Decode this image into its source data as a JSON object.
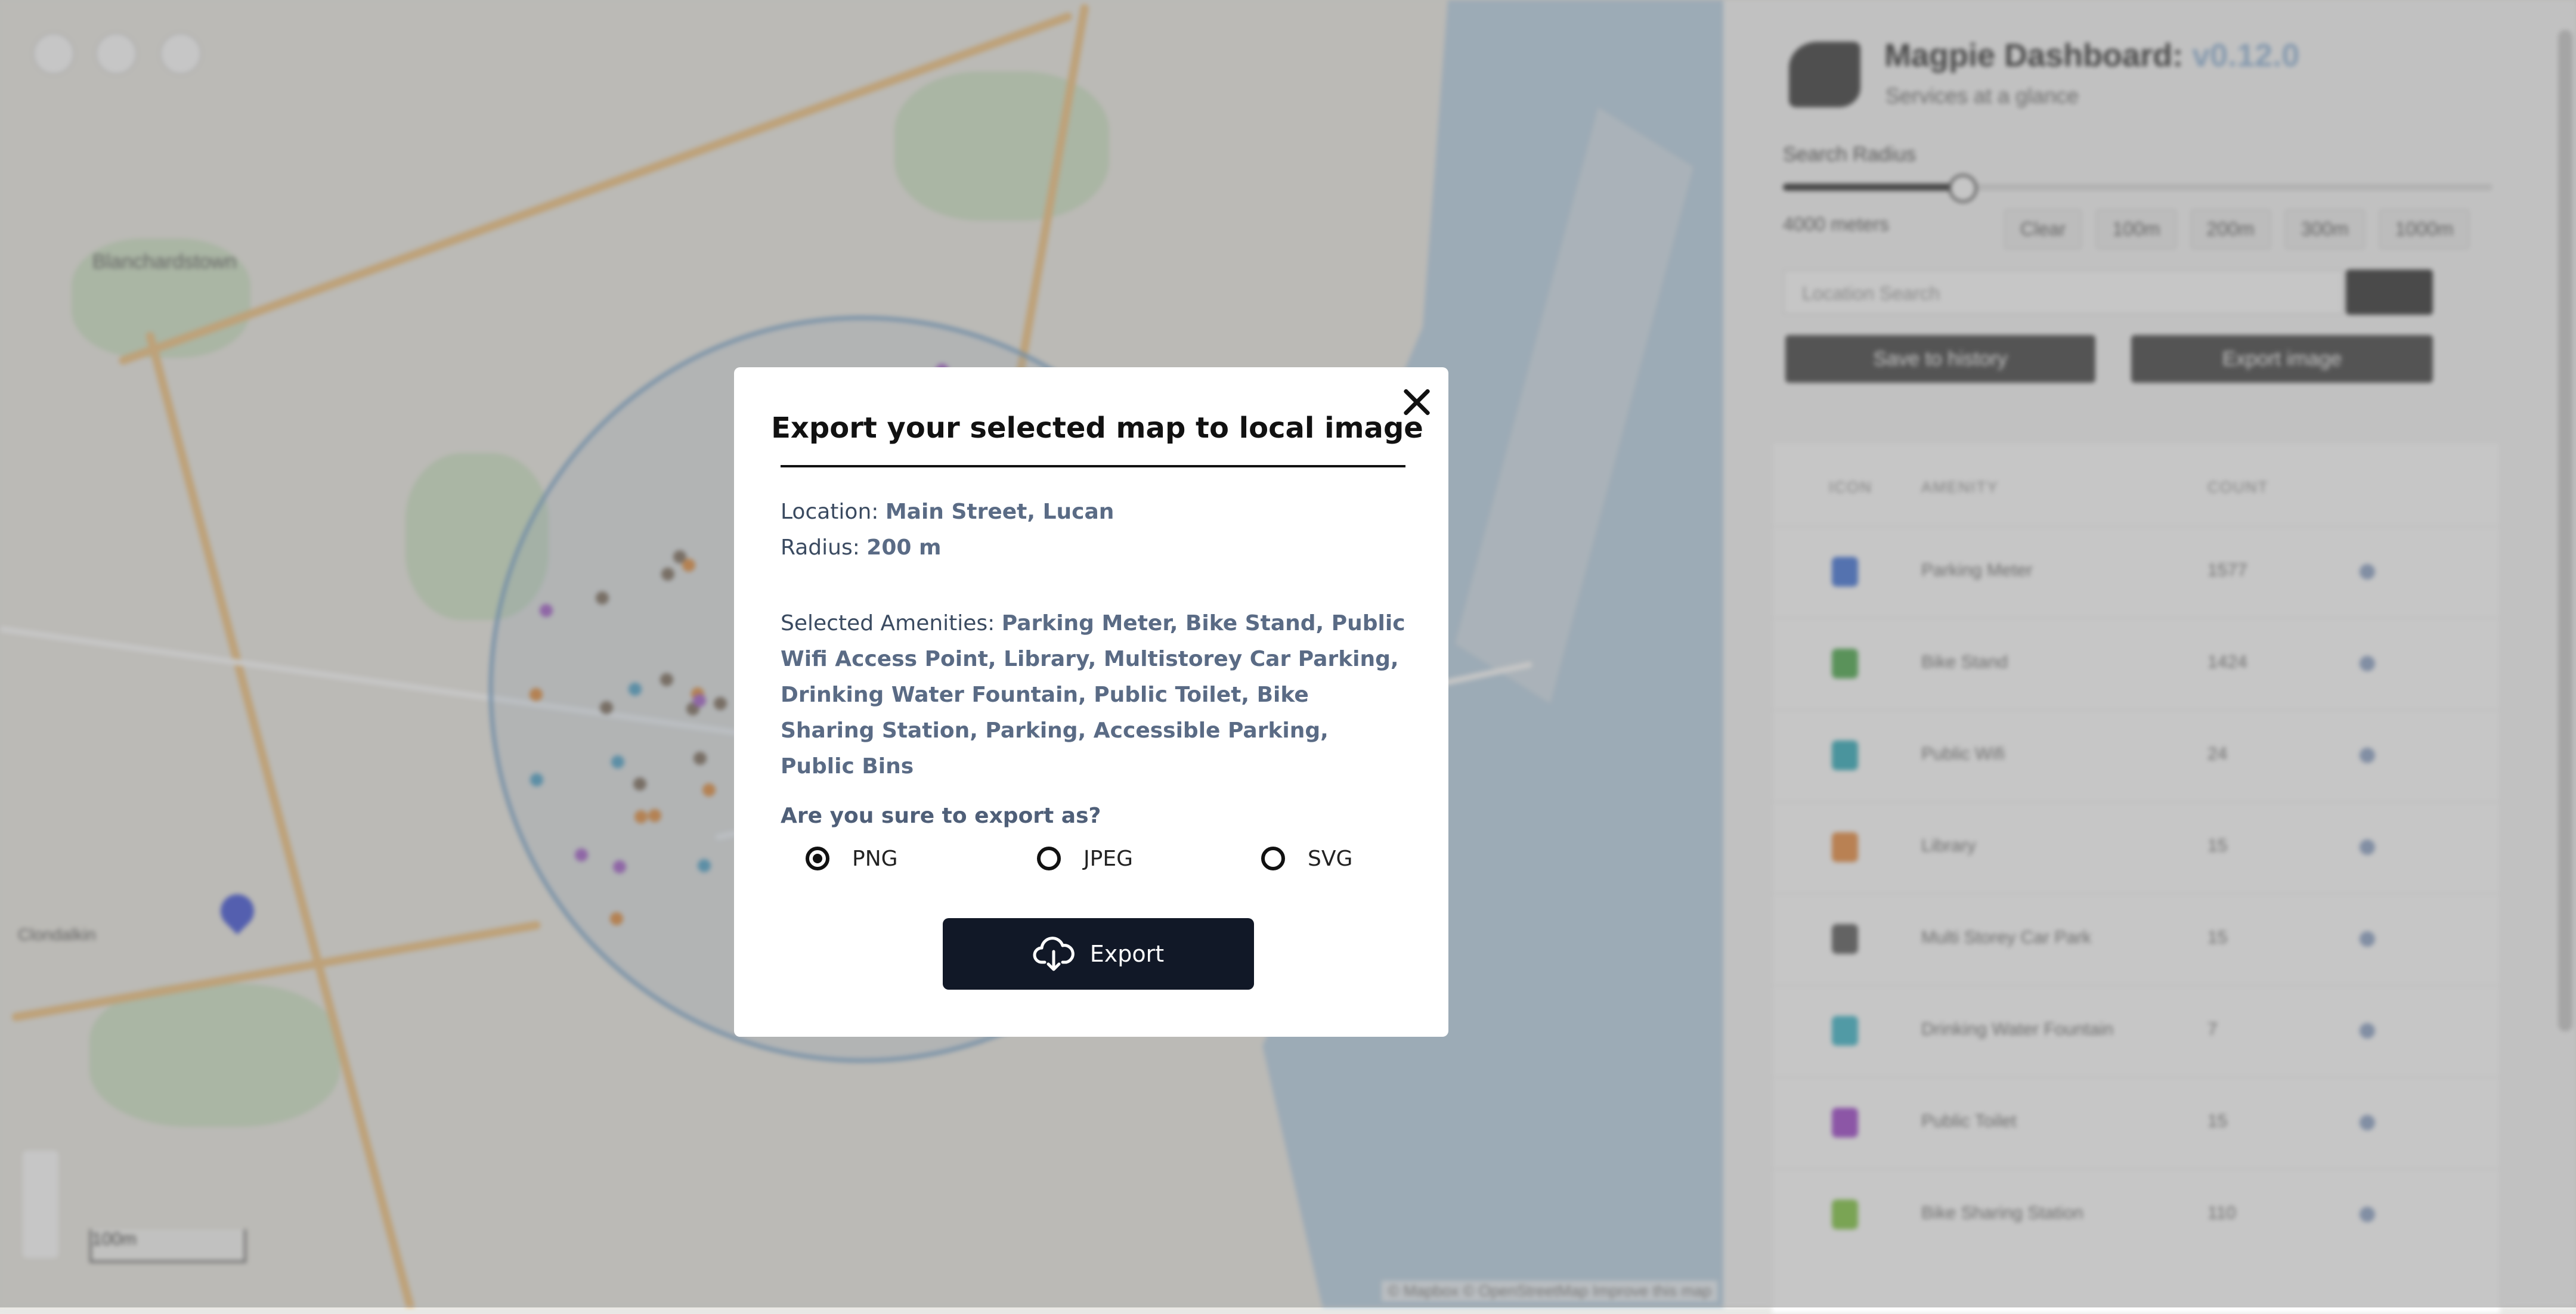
{
  "map": {
    "labels": [
      "Blanchardstown",
      "Clondalkin"
    ],
    "scale_label": "100m",
    "attribution": "© Mapbox © OpenStreetMap Improve this map"
  },
  "sidebar": {
    "title": "Magpie Dashboard:",
    "version": "v0.12.0",
    "subtitle": "Services at a glance",
    "search_radius_label": "Search Radius",
    "radius_readout": "4000 meters",
    "radius_fraction": 0.25,
    "radius_chips": [
      "Clear",
      "100m",
      "200m",
      "300m",
      "1000m"
    ],
    "location_placeholder": "Location Search",
    "save_button": "Save to history",
    "export_button": "Export image",
    "table": {
      "headers": [
        "ICON",
        "AMENITY",
        "COUNT"
      ],
      "rows": [
        {
          "name": "Parking Meter",
          "count": "1577",
          "color": "#3b6fd8"
        },
        {
          "name": "Bike Stand",
          "count": "1424",
          "color": "#46a646"
        },
        {
          "name": "Public Wifi",
          "count": "24",
          "color": "#2aa9b8"
        },
        {
          "name": "Library",
          "count": "15",
          "color": "#e8883a"
        },
        {
          "name": "Multi Storey Car Park",
          "count": "15",
          "color": "#555555"
        },
        {
          "name": "Drinking Water Fountain",
          "count": "7",
          "color": "#36b3c7"
        },
        {
          "name": "Public Toilet",
          "count": "15",
          "color": "#9b3fc9"
        },
        {
          "name": "Bike Sharing Station",
          "count": "110",
          "color": "#7cc43c"
        }
      ]
    }
  },
  "modal": {
    "title": "Export your selected map to local image",
    "location_label": "Location:",
    "location_value": "Main Street, Lucan",
    "radius_label": "Radius:",
    "radius_value": "200 m",
    "amenities_label": "Selected Amenities:",
    "amenities_value": "Parking Meter, Bike Stand, Public Wifi Access Point, Library, Multistorey Car Parking, Drinking Water Fountain, Public Toilet, Bike Sharing Station, Parking, Accessible Parking, Public Bins",
    "confirm_question": "Are you sure to export as?",
    "formats": [
      {
        "label": "PNG",
        "selected": true
      },
      {
        "label": "JPEG",
        "selected": false
      },
      {
        "label": "SVG",
        "selected": false
      }
    ],
    "export_label": "Export"
  }
}
